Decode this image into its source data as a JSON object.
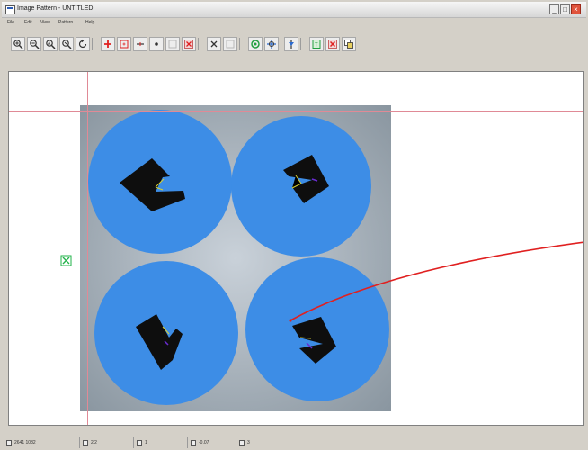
{
  "window": {
    "title": "Image Pattern - UNTITLED",
    "controls": [
      "minimize",
      "maximize",
      "close"
    ]
  },
  "menu": {
    "items": [
      "File",
      "Edit",
      "View",
      "Pattern",
      "Help"
    ]
  },
  "toolbar": {
    "buttons": [
      {
        "name": "zoom-in",
        "icon": "zoom-in-icon"
      },
      {
        "name": "zoom-out",
        "icon": "zoom-out-icon"
      },
      {
        "name": "zoom-fit",
        "icon": "zoom-fit-icon"
      },
      {
        "name": "zoom-actual",
        "icon": "zoom-actual-icon"
      },
      {
        "name": "rotate",
        "icon": "rotate-icon"
      },
      {
        "name": "add-cross",
        "icon": "plus-icon"
      },
      {
        "name": "add-box",
        "icon": "box-icon"
      },
      {
        "name": "add-line",
        "icon": "line-icon"
      },
      {
        "name": "add-point",
        "icon": "dot-icon"
      },
      {
        "name": "blank",
        "icon": "blank-icon"
      },
      {
        "name": "delete-marker",
        "icon": "delete-icon"
      },
      {
        "name": "cut",
        "icon": "cut-icon"
      },
      {
        "name": "blank-2",
        "icon": "blank-icon"
      },
      {
        "name": "target",
        "icon": "target-icon"
      },
      {
        "name": "align",
        "icon": "align-icon"
      },
      {
        "name": "center",
        "icon": "center-icon"
      },
      {
        "name": "train",
        "icon": "train-icon"
      },
      {
        "name": "clear",
        "icon": "clear-icon"
      },
      {
        "name": "copy",
        "icon": "copy-icon"
      }
    ]
  },
  "statusbar": {
    "coords": "2641 1082",
    "size": "2/2",
    "count": "1",
    "angle": "-0.07",
    "extra": "3"
  },
  "colors": {
    "accent_red": "#e02020",
    "puck_blue": "#3d8de6",
    "guide_line": "#e08a96",
    "marker_green": "#22b34a"
  }
}
